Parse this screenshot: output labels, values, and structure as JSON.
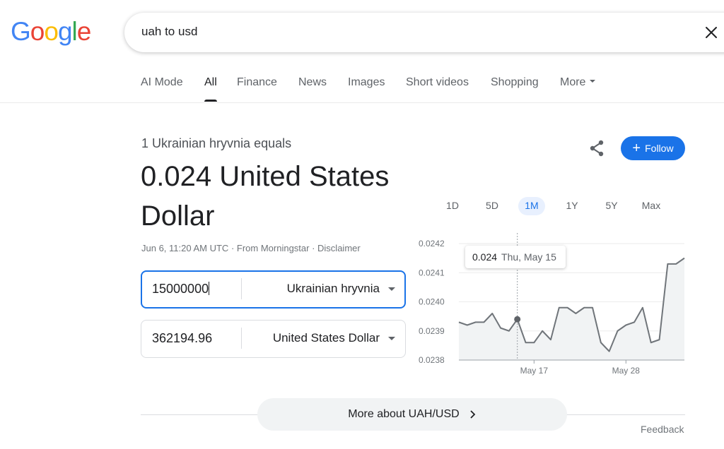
{
  "logo": {
    "letters": [
      "G",
      "o",
      "o",
      "g",
      "l",
      "e"
    ],
    "colors": [
      "#4285f4",
      "#ea4335",
      "#fbbc05",
      "#4285f4",
      "#34a853",
      "#ea4335"
    ]
  },
  "search": {
    "query": "uah to usd",
    "clear_icon": "close-icon"
  },
  "tabs": [
    {
      "label": "AI Mode",
      "active": false
    },
    {
      "label": "All",
      "active": true
    },
    {
      "label": "Finance",
      "active": false
    },
    {
      "label": "News",
      "active": false
    },
    {
      "label": "Images",
      "active": false
    },
    {
      "label": "Short videos",
      "active": false
    },
    {
      "label": "Shopping",
      "active": false
    },
    {
      "label": "More",
      "active": false
    }
  ],
  "converter": {
    "equals_label": "1 Ukrainian hryvnia equals",
    "result": "0.024 United States Dollar",
    "timestamp": "Jun 6, 11:20 AM UTC",
    "source": "From Morningstar",
    "disclaimer": "Disclaimer",
    "separator": " · ",
    "from": {
      "amount": "15000000",
      "currency": "Ukrainian hryvnia"
    },
    "to": {
      "amount": "362194.96",
      "currency": "United States Dollar"
    },
    "follow_label": "Follow",
    "share_icon": "share-icon"
  },
  "ranges": [
    "1D",
    "5D",
    "1M",
    "1Y",
    "5Y",
    "Max"
  ],
  "active_range": "1M",
  "tooltip": {
    "value": "0.024",
    "date": "Thu, May 15"
  },
  "chart_data": {
    "type": "area",
    "y_ticks": [
      "0.0242",
      "0.0241",
      "0.0240",
      "0.0239",
      "0.0238"
    ],
    "ylim": [
      0.0238,
      0.0242
    ],
    "x_tick_labels": [
      {
        "index": 9,
        "label": "May 17"
      },
      {
        "index": 20,
        "label": "May 28"
      }
    ],
    "highlight_index": 7,
    "values": [
      0.02393,
      0.02392,
      0.02393,
      0.02393,
      0.02396,
      0.02391,
      0.0239,
      0.02394,
      0.02386,
      0.02386,
      0.0239,
      0.02387,
      0.02398,
      0.02398,
      0.02396,
      0.02398,
      0.02398,
      0.02386,
      0.02383,
      0.0239,
      0.02392,
      0.02393,
      0.02398,
      0.02386,
      0.02387,
      0.02413,
      0.02413,
      0.02415
    ],
    "line_color": "#70757a",
    "grid": true
  },
  "more_about": "More about UAH/USD",
  "feedback": "Feedback"
}
